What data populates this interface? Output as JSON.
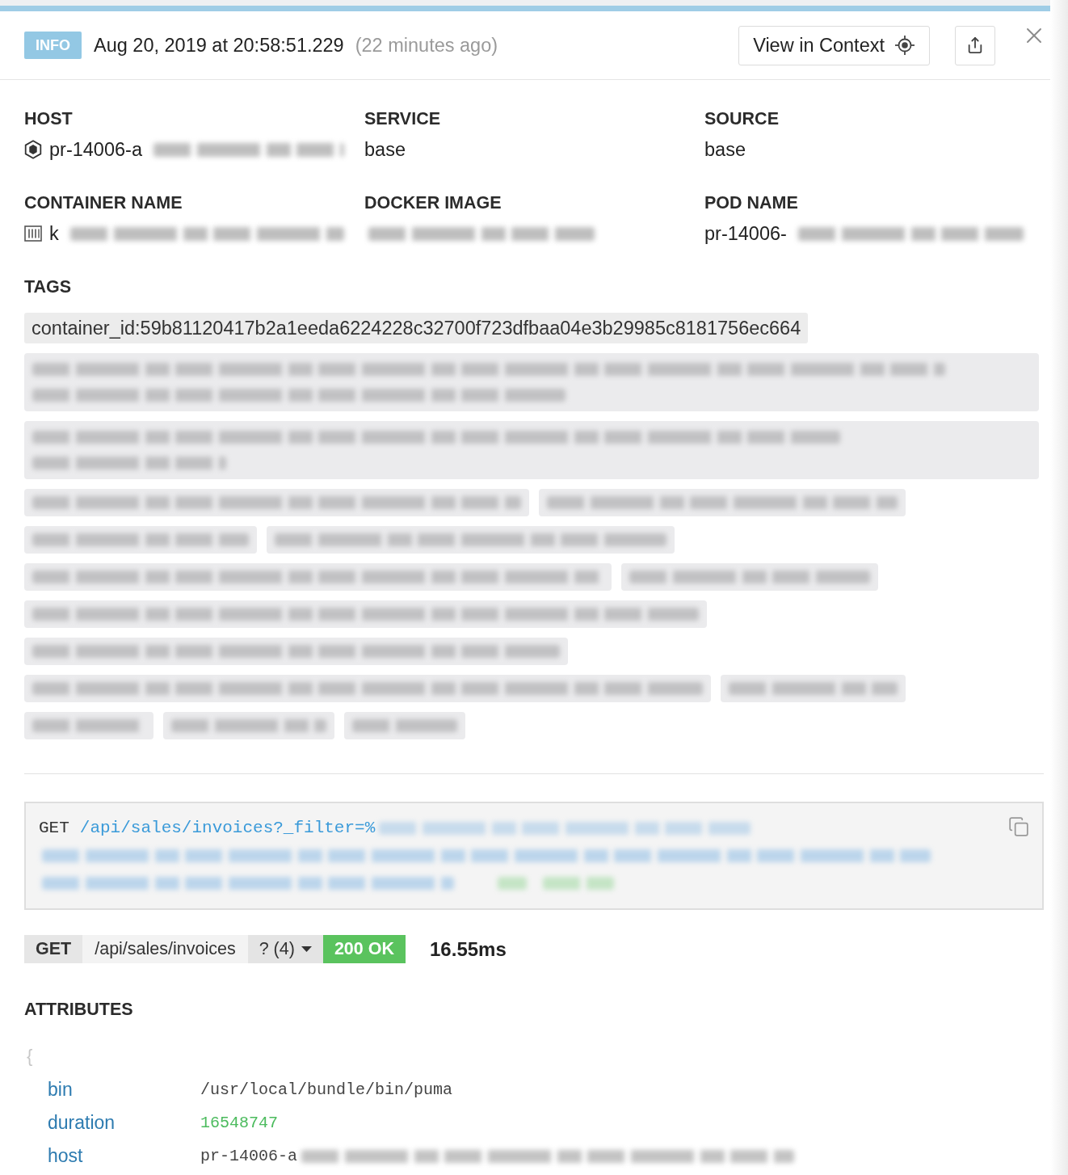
{
  "header": {
    "level": {
      "label": "INFO",
      "kind": "info"
    },
    "timestamp": "Aug 20, 2019 at 20:58:51.229",
    "relative_time": "(22 minutes ago)",
    "actions": [
      {
        "kind": "context",
        "label": "View in Context"
      },
      {
        "kind": "share"
      },
      {
        "kind": "close"
      }
    ]
  },
  "fields": [
    {
      "kind": "host",
      "label": "HOST",
      "value": "pr-14006-a",
      "redacted": true
    },
    {
      "kind": "plain",
      "label": "SERVICE",
      "value": "base",
      "redacted": false
    },
    {
      "kind": "plain",
      "label": "SOURCE",
      "value": "base",
      "redacted": false
    },
    {
      "kind": "container",
      "label": "CONTAINER NAME",
      "value": "k",
      "redacted": true
    },
    {
      "kind": "plain",
      "label": "DOCKER IMAGE",
      "redacted": true
    },
    {
      "kind": "plain",
      "label": "POD NAME",
      "value": "pr-14006-",
      "redacted": true
    }
  ],
  "tags": {
    "title": "TAGS",
    "items": [
      {
        "kind": "text",
        "text": "container_id:59b81120417b2a1eeda6224228c32700f723dfbaa04e3b29985c8181756ec664"
      },
      {
        "kind": "redacted"
      },
      {
        "kind": "redacted"
      },
      {
        "kind": "redacted"
      },
      {
        "kind": "redacted"
      },
      {
        "kind": "redacted"
      },
      {
        "kind": "redacted"
      },
      {
        "kind": "redacted"
      },
      {
        "kind": "redacted"
      },
      {
        "kind": "redacted"
      },
      {
        "kind": "redacted"
      },
      {
        "kind": "redacted"
      },
      {
        "kind": "redacted"
      },
      {
        "kind": "redacted"
      },
      {
        "kind": "redacted"
      },
      {
        "kind": "redacted"
      }
    ]
  },
  "request_line": {
    "method": "GET",
    "url": "/api/sales/invoices?_filter=%",
    "redacted": true
  },
  "request_summary": {
    "method": "GET",
    "path": "/api/sales/invoices",
    "query": "? (4)",
    "status": {
      "label": "200 OK",
      "kind": "success"
    },
    "duration": "16.55ms"
  },
  "attributes": {
    "title": "ATTRIBUTES",
    "open_brace": "{",
    "rows": [
      {
        "key": "bin",
        "value": "/usr/local/bundle/bin/puma",
        "kind": "string",
        "redacted": false
      },
      {
        "key": "duration",
        "value": "16548747",
        "kind": "number",
        "redacted": false
      },
      {
        "key": "host",
        "value": "pr-14006-a",
        "kind": "string",
        "redacted": true
      }
    ]
  }
}
